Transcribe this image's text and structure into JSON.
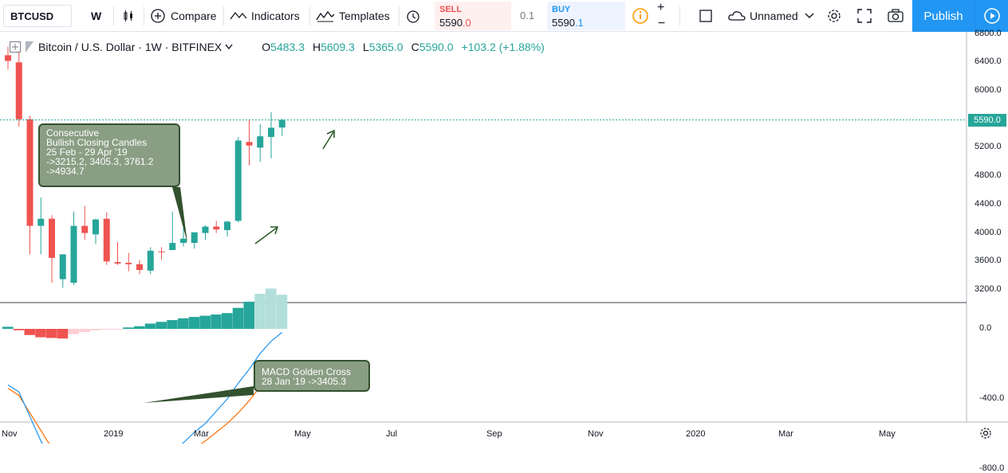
{
  "toolbar": {
    "symbol": "BTCUSD",
    "interval": "W",
    "compare_label": "Compare",
    "indicators_label": "Indicators",
    "templates_label": "Templates",
    "sell_label": "SELL",
    "sell_price_main": "5590",
    "sell_price_tail": ".0",
    "spread": "0.1",
    "buy_label": "BUY",
    "buy_price_main": "5590",
    "buy_price_tail": ".1",
    "layout_name": "Unnamed",
    "publish_label": "Publish"
  },
  "legend": {
    "title": "Bitcoin / U.S. Dollar · 1W · BITFINEX",
    "open": "5483.3",
    "high": "5609.3",
    "low": "5365.0",
    "close": "5590.0",
    "change": "+103.2 (+1.88%)"
  },
  "annotations": {
    "candles": [
      "Consecutive",
      "Bullish Closing Candles",
      "25 Feb - 29 Apr '19",
      "->3215.2, 3405.3, 3761.2",
      "->4934.7"
    ],
    "macd": [
      "MACD Golden Cross",
      "28 Jan '19 ->3405.3"
    ]
  },
  "price_axis": [
    "6800.0",
    "6400.0",
    "6000.0",
    "5200.0",
    "4800.0",
    "4400.0",
    "4000.0",
    "3600.0",
    "3200.0"
  ],
  "last_price": "5590.0",
  "macd_axis": [
    "0.0",
    "-400.0",
    "-800.0"
  ],
  "time_axis": [
    "Nov",
    "2019",
    "Mar",
    "May",
    "Jul",
    "Sep",
    "Nov",
    "2020",
    "Mar",
    "May"
  ],
  "colors": {
    "up": "#26a69a",
    "down": "#ef5350",
    "macd": "#2196f3",
    "signal": "#ff6d00",
    "accent": "#2196f3"
  },
  "chart_data": {
    "type": "candlestick",
    "interval": "1W",
    "candles": [
      {
        "o": 6500,
        "h": 6620,
        "l": 6300,
        "c": 6420
      },
      {
        "o": 6400,
        "h": 6550,
        "l": 5500,
        "c": 5600
      },
      {
        "o": 5600,
        "h": 5650,
        "l": 3700,
        "c": 4100
      },
      {
        "o": 4100,
        "h": 4500,
        "l": 3700,
        "c": 4200
      },
      {
        "o": 4200,
        "h": 4250,
        "l": 3300,
        "c": 3650
      },
      {
        "o": 3350,
        "h": 3700,
        "l": 3230,
        "c": 3700
      },
      {
        "o": 3300,
        "h": 4300,
        "l": 3270,
        "c": 4100
      },
      {
        "o": 4100,
        "h": 4380,
        "l": 3900,
        "c": 4000
      },
      {
        "o": 3980,
        "h": 4200,
        "l": 3850,
        "c": 4190
      },
      {
        "o": 4200,
        "h": 4290,
        "l": 3550,
        "c": 3600
      },
      {
        "o": 3590,
        "h": 3870,
        "l": 3550,
        "c": 3570
      },
      {
        "o": 3580,
        "h": 3720,
        "l": 3460,
        "c": 3560
      },
      {
        "o": 3560,
        "h": 3620,
        "l": 3420,
        "c": 3480
      },
      {
        "o": 3470,
        "h": 3800,
        "l": 3420,
        "c": 3750
      },
      {
        "o": 3740,
        "h": 3800,
        "l": 3620,
        "c": 3730
      },
      {
        "o": 3760,
        "h": 4300,
        "l": 3760,
        "c": 3860
      },
      {
        "o": 3860,
        "h": 4070,
        "l": 3810,
        "c": 3920
      },
      {
        "o": 3860,
        "h": 4000,
        "l": 3780,
        "c": 4010
      },
      {
        "o": 4000,
        "h": 4110,
        "l": 3900,
        "c": 4090
      },
      {
        "o": 4090,
        "h": 4170,
        "l": 4000,
        "c": 4050
      },
      {
        "o": 4040,
        "h": 4170,
        "l": 3950,
        "c": 4160
      },
      {
        "o": 4170,
        "h": 5350,
        "l": 4150,
        "c": 5300
      },
      {
        "o": 5280,
        "h": 5600,
        "l": 4950,
        "c": 5230
      },
      {
        "o": 5200,
        "h": 5530,
        "l": 5000,
        "c": 5360
      },
      {
        "o": 5350,
        "h": 5700,
        "l": 5050,
        "c": 5480
      },
      {
        "o": 5483.3,
        "h": 5609.3,
        "l": 5365,
        "c": 5590
      }
    ],
    "macd": {
      "histogram": [
        12,
        -8,
        -35,
        -48,
        -52,
        -55,
        -30,
        -18,
        -8,
        -5,
        -2,
        8,
        15,
        30,
        40,
        50,
        60,
        68,
        75,
        82,
        90,
        120,
        155,
        200,
        230,
        195
      ],
      "macd_line": [
        -320,
        -360,
        -500,
        -640,
        -740,
        -850,
        -830,
        -820,
        -810,
        -800,
        -810,
        -820,
        -810,
        -780,
        -740,
        -700,
        -650,
        -590,
        -540,
        -470,
        -400,
        -310,
        -230,
        -140,
        -70,
        -20
      ],
      "signal_line": [
        -340,
        -380,
        -480,
        -580,
        -680,
        -770,
        -800,
        -820,
        -830,
        -830,
        -830,
        -820,
        -810,
        -800,
        -780,
        -760,
        -720,
        -680,
        -640,
        -590,
        -540,
        -480,
        -410,
        -330,
        -260,
        -180
      ]
    },
    "ylim_price": [
      3050,
      6850
    ],
    "ylim_macd": [
      -950,
      250
    ],
    "grid": false
  }
}
